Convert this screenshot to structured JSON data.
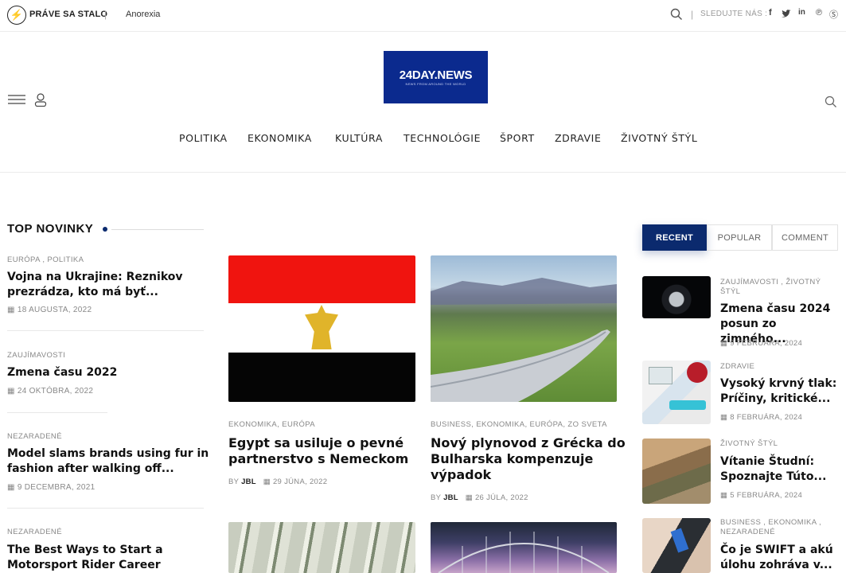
{
  "topbar": {
    "breaking_label": "PRÁVE SA STALO",
    "breaking_link": "Anorexia",
    "follow_label": "SLEDUJTE NÁS :"
  },
  "logo": {
    "title": "24DAY.NEWS",
    "subtitle": "NEWS FROM AROUND THE WORLD"
  },
  "nav": [
    "POLITIKA",
    "EKONOMIKA",
    "KULTÚRA",
    "TECHNOLÓGIE",
    "ŠPORT",
    "ZDRAVIE",
    "ŽIVOTNÝ ŠTÝL"
  ],
  "top_news": {
    "heading": "TOP NOVINKY",
    "items": [
      {
        "category": "EURÓPA , POLITIKA",
        "title_l1": "Vojna na Ukrajine: Reznikov",
        "title_l2": "prezrádza, kto má byť...",
        "date": "18 AUGUSTA, 2022"
      },
      {
        "category": "ZAUJÍMAVOSTI",
        "title_l1": "Zmena času 2022",
        "title_l2": "",
        "date": "24 OKTÓBRA, 2022"
      },
      {
        "category": "NEZARADENÉ",
        "title_l1": "Model slams brands using fur in",
        "title_l2": "fashion after walking off...",
        "date": "9 DECEMBRA, 2021"
      },
      {
        "category": "NEZARADENÉ",
        "title_l1": "The Best Ways to Start a",
        "title_l2": "Motorsport Rider Career",
        "date": ""
      }
    ]
  },
  "cards": [
    {
      "category": "EKONOMIKA, EURÓPA",
      "title_l1": "Egypt sa usiluje o pevné",
      "title_l2": "partnerstvo s Nemeckom",
      "title_l3": "",
      "by": "BY",
      "author": "JBL",
      "date": "29 JÚNA, 2022"
    },
    {
      "category": "BUSINESS, EKONOMIKA, EURÓPA, ZO SVETA",
      "title_l1": "Nový plynovod z Grécka do",
      "title_l2": "Bulharska kompenzuje",
      "title_l3": "výpadok",
      "by": "BY",
      "author": "JBL",
      "date": "26 JÚLA, 2022"
    }
  ],
  "tabs": [
    "RECENT",
    "POPULAR",
    "COMMENT"
  ],
  "recent": [
    {
      "cat_l1": "ZAUJÍMAVOSTI , ŽIVOTNÝ",
      "cat_l2": "ŠTÝL",
      "title_l1": "Zmena času 2024",
      "title_l2": "posun zo zimného...",
      "date": "9 FEBRUÁRA, 2024"
    },
    {
      "cat_l1": "ZDRAVIE",
      "cat_l2": "",
      "title_l1": "Vysoký krvný tlak:",
      "title_l2": "Príčiny, kritické...",
      "date": "8 FEBRUÁRA, 2024"
    },
    {
      "cat_l1": "ŽIVOTNÝ ŠTÝL",
      "cat_l2": "",
      "title_l1": "Vítanie Študní:",
      "title_l2": "Spoznajte Túto...",
      "date": "5 FEBRUÁRA, 2024"
    },
    {
      "cat_l1": "BUSINESS , EKONOMIKA ,",
      "cat_l2": "NEZARADENÉ",
      "title_l1": "Čo je SWIFT a akú",
      "title_l2": "úlohu zohráva v...",
      "date": ""
    }
  ]
}
